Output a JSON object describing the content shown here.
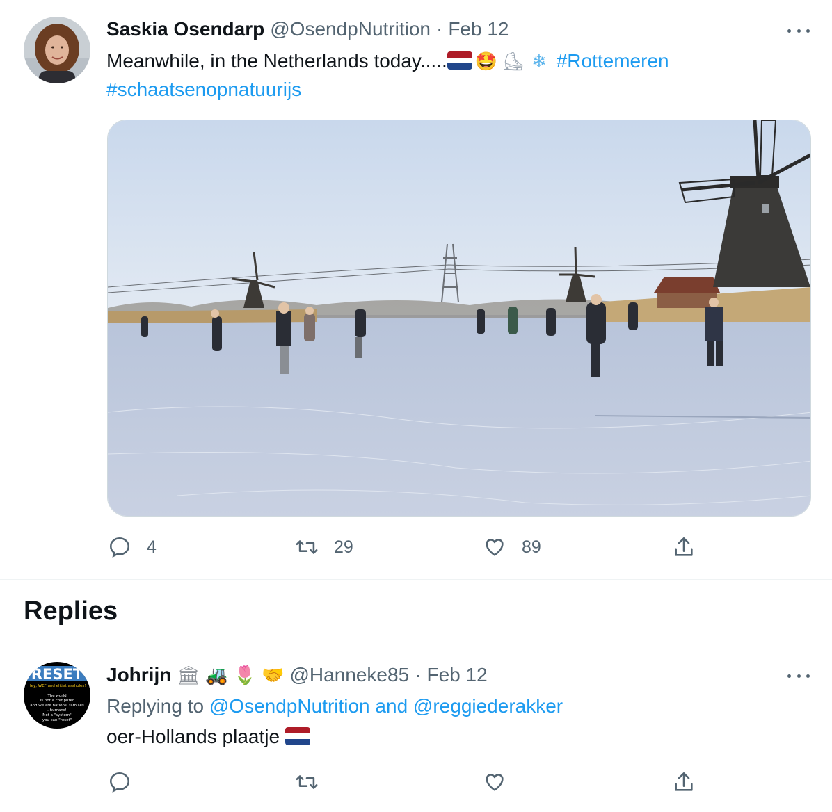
{
  "tweet": {
    "author_name": "Saskia Osendarp",
    "author_handle": "@OsendpNutrition",
    "separator": "·",
    "date": "Feb 12",
    "text_prefix": "Meanwhile, in the Netherlands today.....",
    "emojis": [
      "🇳🇱",
      "🤩",
      "⛸",
      "❄"
    ],
    "hashtags": [
      "#Rottemeren",
      "#schaatsenopnatuurijs"
    ],
    "media_description_icon": "photo-skating-windmills",
    "counts": {
      "replies": "4",
      "retweets": "29",
      "likes": "89"
    }
  },
  "section": {
    "replies_title": "Replies"
  },
  "reply": {
    "author_name": "Johrijn",
    "author_emojis": [
      "🏛",
      "🚜",
      "🌷",
      "🤝"
    ],
    "author_handle": "@Hanneke85",
    "separator": "·",
    "date": "Feb 12",
    "replying_to_label": "Replying to",
    "replying_to_user1": "@OsendpNutrition",
    "replying_and": "and",
    "replying_to_user2": "@reggiederakker",
    "text": "oer-Hollands plaatje",
    "text_emoji": "🇳🇱",
    "avatar_text": {
      "banner": "RESET",
      "line1": "Hey, WEF and elitist assholes!",
      "line2": "The world",
      "line3": "is not a computer",
      "line4": "and we are nations, families",
      "line5": "..humans!",
      "line6": "Not a \"system\"",
      "line7": "you can \"reset\""
    }
  },
  "colors": {
    "accent": "#1d9bf0",
    "secondary_text": "#536471",
    "primary_text": "#0f1419"
  }
}
